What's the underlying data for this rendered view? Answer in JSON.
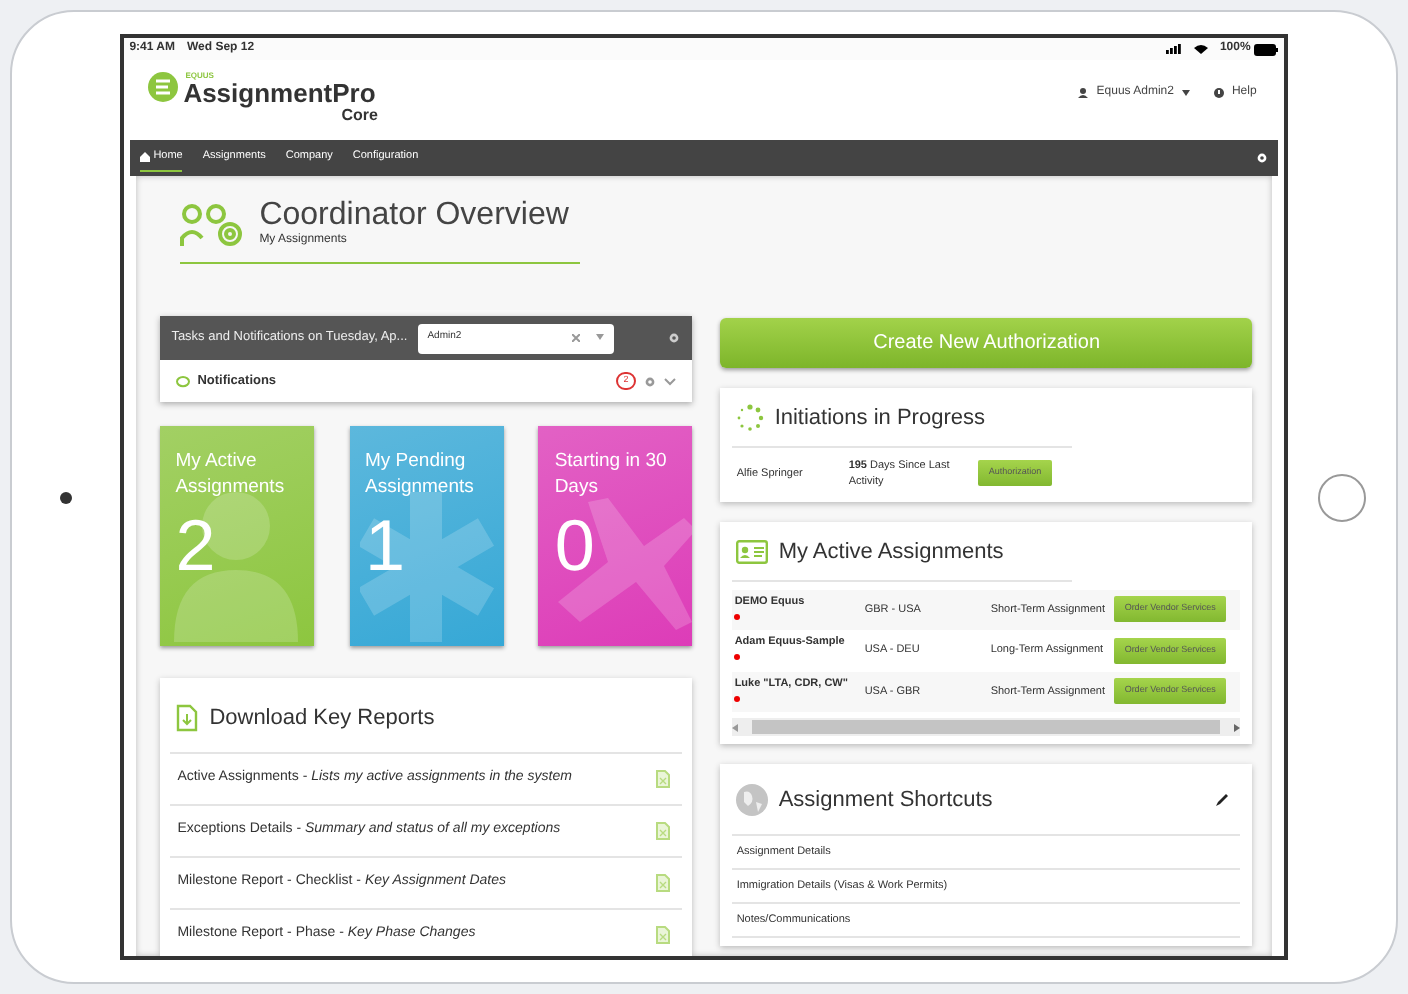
{
  "status_bar": {
    "time": "9:41 AM",
    "date": "Wed Sep 12",
    "battery": "100%"
  },
  "header": {
    "brand_small": "EQUUS",
    "brand": "AssignmentPro",
    "edition": "Core",
    "user": "Equus Admin2",
    "help": "Help"
  },
  "nav": [
    {
      "label": "Home",
      "selected": true
    },
    {
      "label": "Assignments",
      "selected": false
    },
    {
      "label": "Company",
      "selected": false
    },
    {
      "label": "Configuration",
      "selected": false
    }
  ],
  "page": {
    "title": "Coordinator Overview",
    "subtitle": "My Assignments"
  },
  "tasks": {
    "title": "Tasks and Notifications on Tuesday, Ap...",
    "select_value": "Admin2",
    "notifications_label": "Notifications",
    "notifications_count": "2"
  },
  "tiles": [
    {
      "kind": "person",
      "label": "My Active Assignments",
      "count": "2",
      "color": "#8dc63f"
    },
    {
      "kind": "asterisk",
      "label": "My Pending Assignments",
      "count": "1",
      "color": "#36a8d6"
    },
    {
      "kind": "plane",
      "label": "Starting in 30 Days",
      "count": "0",
      "color": "#dd3cb8"
    }
  ],
  "reports": {
    "title": "Download Key Reports",
    "items": [
      {
        "text": "Active Assignments - *Lists my active assignments in the system*"
      },
      {
        "text": "Exceptions Details - *Summary and status of all my exceptions*"
      },
      {
        "text": "Milestone Report - Checklist - *Key Assignment Dates*"
      },
      {
        "text": "Milestone Report - Phase - *Key Phase Changes*"
      }
    ]
  },
  "create_button": "Create New Authorization",
  "initiations": {
    "title": "Initiations in Progress",
    "rows": [
      {
        "name": "Alfie Springer",
        "status": "**195** Days Since Last Activity",
        "action": "Authorization"
      }
    ]
  },
  "active_assignments": {
    "title": "My Active Assignments",
    "rows": [
      {
        "name": "DEMO Equus",
        "flagged": true,
        "route": "GBR - USA",
        "type": "Short-Term Assignment",
        "action": "Order Vendor Services"
      },
      {
        "name": "Adam Equus-Sample",
        "flagged": true,
        "route": "USA - DEU",
        "type": "Long-Term Assignment",
        "action": "Order Vendor Services"
      },
      {
        "name": "Luke \"LTA, CDR, CW\"",
        "flagged": true,
        "route": "USA - GBR",
        "type": "Short-Term Assignment",
        "action": "Order Vendor Services"
      }
    ]
  },
  "shortcuts": {
    "title": "Assignment Shortcuts",
    "items": [
      {
        "label": "Assignment Details"
      },
      {
        "label": "Immigration Details (Visas & Work Permits)"
      },
      {
        "label": "Notes/Communications"
      }
    ]
  }
}
